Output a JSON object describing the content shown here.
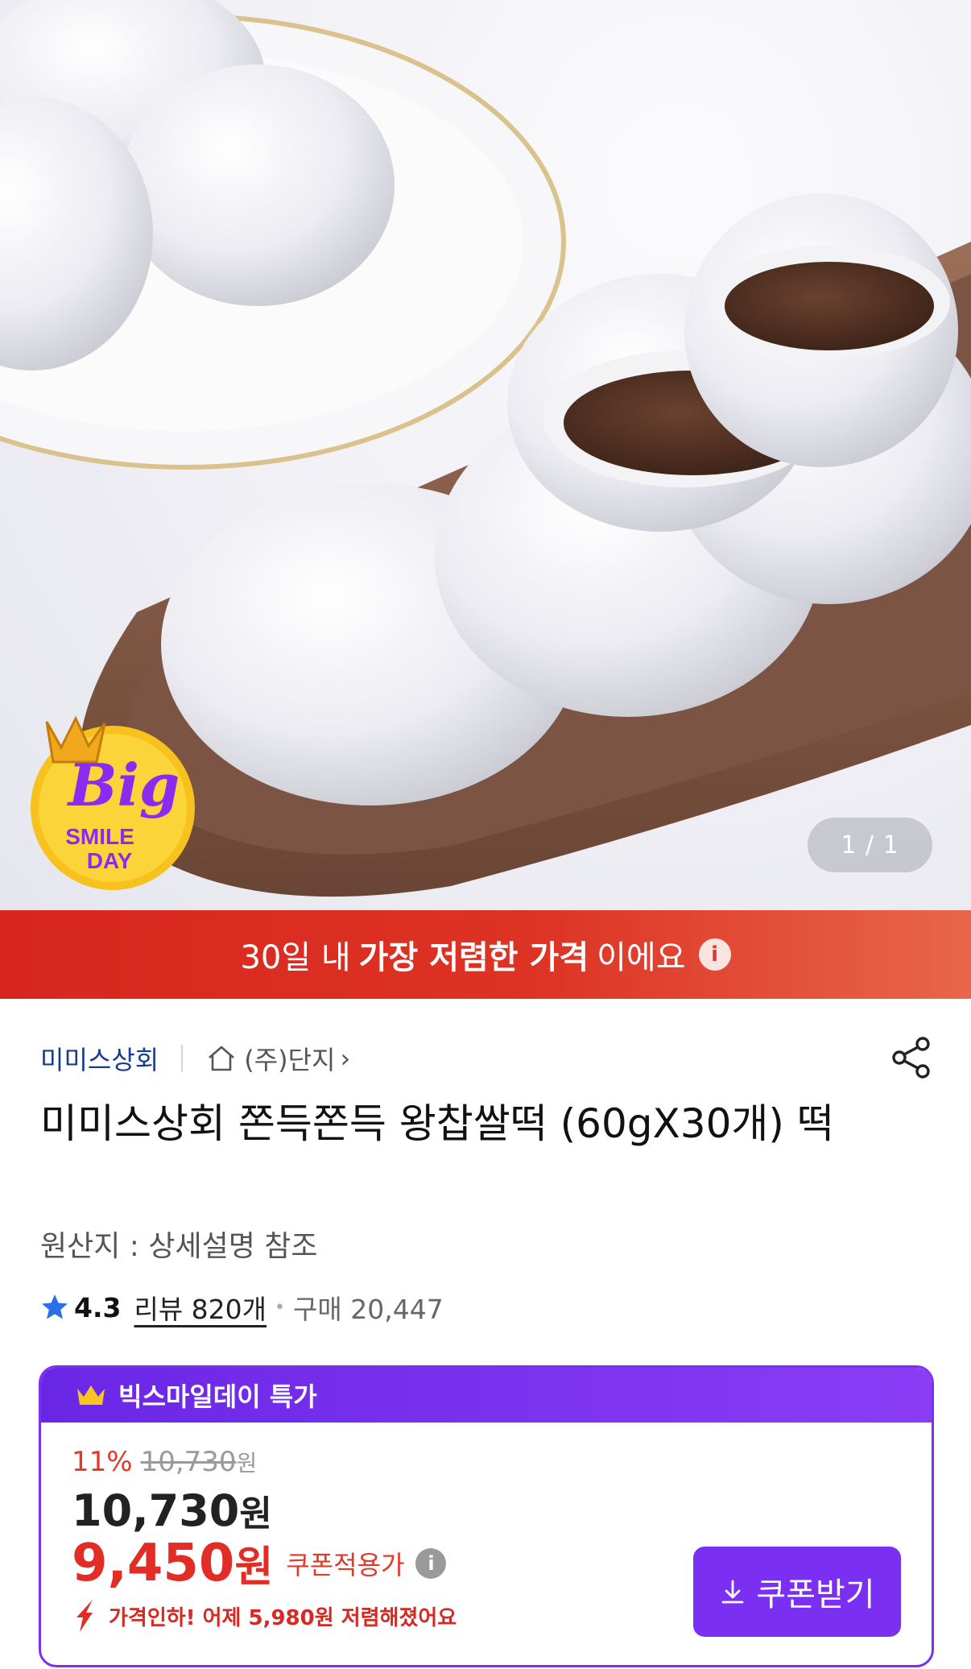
{
  "hero": {
    "badge_big": "Big",
    "badge_line1": "SMILE",
    "badge_line2": "DAY",
    "image_counter": "1 / 1"
  },
  "banner": {
    "part1": "30일 내",
    "part2": "가장 저렴한 가격",
    "part3": "이에요",
    "info_icon": "info-icon"
  },
  "seller": {
    "name": "미미스상회",
    "store_label": "(주)단지",
    "chevron": "›"
  },
  "product": {
    "title": "미미스상회 쫀득쫀득 왕찹쌀떡 (60gX30개) 떡",
    "origin": "원산지 : 상세설명 참조",
    "rating": "4.3",
    "reviews": "리뷰 820개",
    "purchases": "구매 20,447"
  },
  "deal": {
    "header": "빅스마일데이 특가",
    "discount_pct": "11%",
    "original_price": "10,730",
    "original_won": "원",
    "price": "10,730",
    "price_won": "원",
    "coupon_price": "9,450",
    "coupon_won": "원",
    "coupon_label": "쿠폰적용가",
    "price_drop": "가격인하! 어제 5,980원 저렴해졌어요",
    "coupon_button": "쿠폰받기"
  },
  "colors": {
    "banner_red": "#d8261e",
    "deal_purple": "#7b2ff2",
    "price_red": "#e22c26",
    "seller_blue": "#1a3b8c",
    "star_blue": "#2b6fe8"
  }
}
